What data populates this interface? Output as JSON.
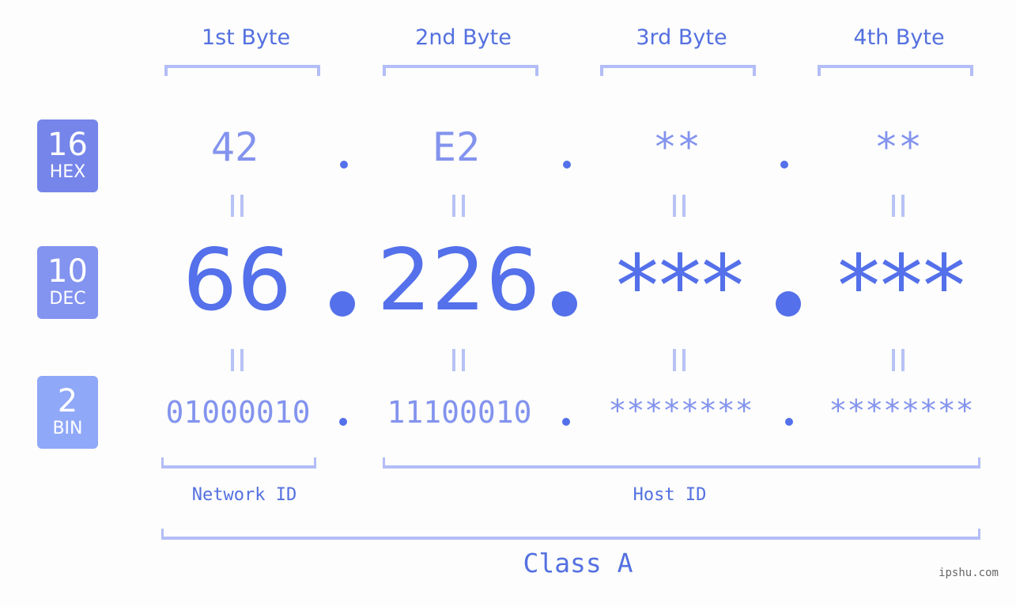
{
  "byte_headers": [
    "1st Byte",
    "2nd Byte",
    "3rd Byte",
    "4th Byte"
  ],
  "bases": {
    "hex": {
      "number": "16",
      "label": "HEX",
      "color": "#7585ea"
    },
    "dec": {
      "number": "10",
      "label": "DEC",
      "color": "#8393f0"
    },
    "bin": {
      "number": "2",
      "label": "BIN",
      "color": "#90a8f8"
    }
  },
  "hex_values": [
    "42",
    "E2",
    "**",
    "**"
  ],
  "dec_values": [
    "66",
    "226",
    "***",
    "***"
  ],
  "bin_values": [
    "01000010",
    "11100010",
    "********",
    "********"
  ],
  "separator": ".",
  "equals_symbol": "=",
  "segments": {
    "network_id": "Network ID",
    "host_id": "Host ID"
  },
  "ip_class": "Class A",
  "watermark": "ipshu.com",
  "colors": {
    "primary_text": "#5470e0",
    "light_value": "#8393ee",
    "bracket": "#b3bdf7",
    "background": "#fcfdfc"
  }
}
